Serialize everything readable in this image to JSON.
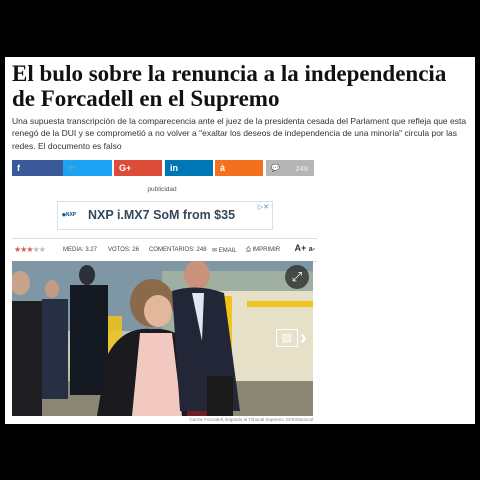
{
  "article": {
    "headline": "El bulo sobre la renuncia a la independencia de Forcadell en el Supremo",
    "lede": "Una supuesta transcripción de la comparecencia ante el juez de la presidenta cesada del Parlament que refleja que esta renegó de la DUI y se comprometió a no volver a \"exaltar los deseos de independencia de una minoría\" circula por las redes. El documento es falso"
  },
  "share": {
    "buttons": [
      {
        "name": "facebook",
        "icon": "f",
        "color": "#3b5998"
      },
      {
        "name": "twitter",
        "icon": "🐦",
        "color": "#1da1f2"
      },
      {
        "name": "google-plus",
        "icon": "G+",
        "color": "#dd4b39"
      },
      {
        "name": "linkedin",
        "icon": "in",
        "color": "#0077b5"
      },
      {
        "name": "meneame",
        "icon": "ȧ",
        "color": "#f3701e"
      }
    ],
    "comments_count": "248",
    "comments_icon": "💬"
  },
  "ad": {
    "label": "publicidad",
    "logo_text": "◆NXP",
    "text": "NXP i.MX7 SoM from $35",
    "adchoices": "▷✕"
  },
  "meta": {
    "rating_stars": 3,
    "rating_max": 5,
    "media_label": "MEDIA: 3.27",
    "votos_label": "VOTOS: 26",
    "comentarios_label": "COMENTARIOS: 248",
    "email_label": "EMAIL",
    "imprimir_label": "IMPRIMIR",
    "font_larger": "A+",
    "font_smaller": "a-"
  },
  "photo": {
    "expand_icon": "⤢",
    "gallery_icon": "▨",
    "next_icon": "›",
    "caption": "Carme Forcadell, llegando al Tribunal Supremo. EFE/Mariscal"
  },
  "colors": {
    "headline": "#111111",
    "star_on": "#d9534f",
    "page_bg": "#ffffff",
    "frame_bg": "#000000"
  }
}
